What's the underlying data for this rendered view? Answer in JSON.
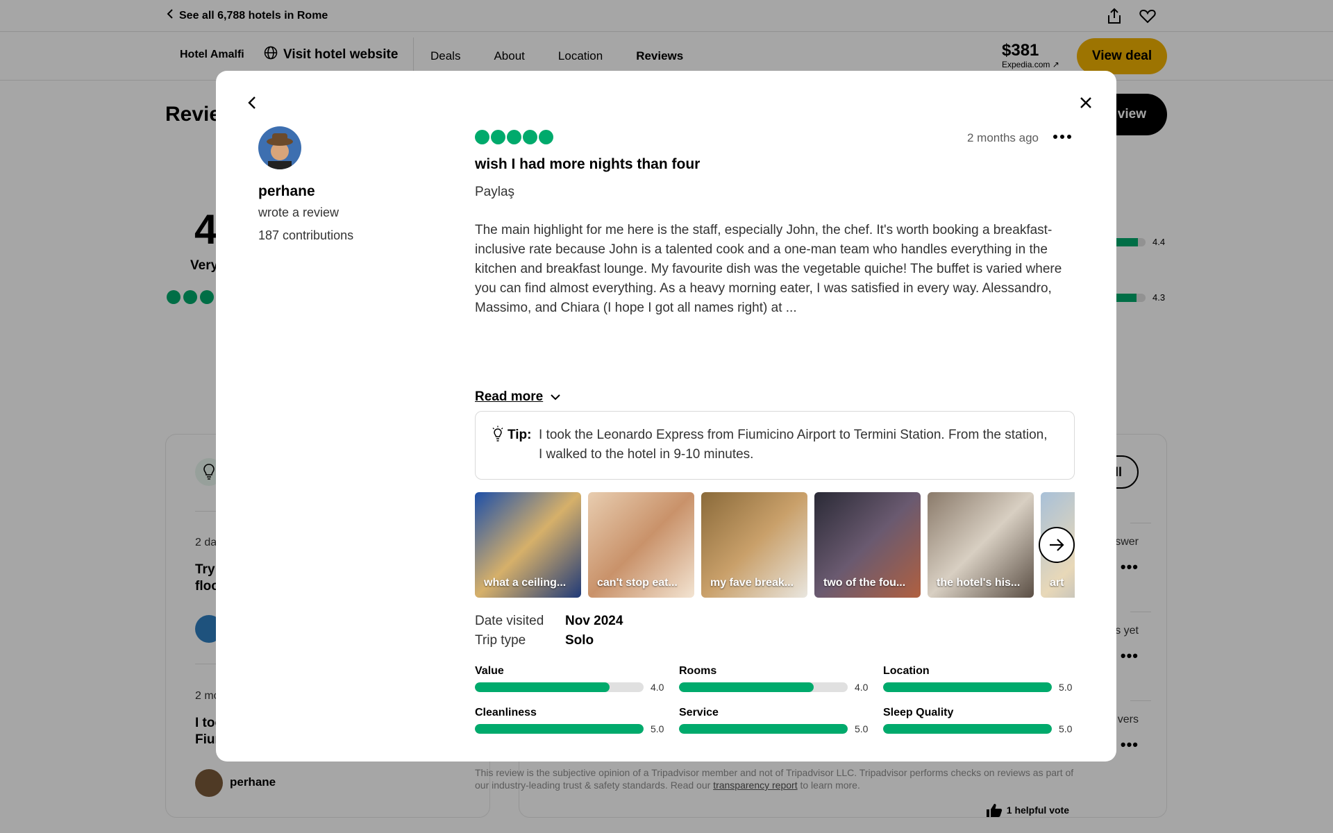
{
  "topbar": {
    "back_label": "See all 6,788 hotels in Rome",
    "share_icon": "share-icon",
    "save_icon": "heart-icon"
  },
  "subnav": {
    "hotel_name": "Hotel Amalfi",
    "visit_website": "Visit hotel website",
    "tabs": [
      "Deals",
      "About",
      "Location",
      "Reviews"
    ],
    "price": "$381",
    "price_source": "Expedia.com ↗",
    "view_deal": "View deal"
  },
  "background": {
    "reviews_heading": "Revie",
    "write_review": "view",
    "rating_value": "4",
    "rating_word": "Very",
    "bar_scores": [
      "4.4",
      "4.3"
    ],
    "bar_fill": [
      0.88,
      0.86
    ],
    "left_card": {
      "item1_date": "2 da",
      "item1_title_l1": "Try",
      "item1_title_l2": "floo",
      "item2_date": "2 mo",
      "item2_title_l1": "I too",
      "item2_title_l2": "Fium",
      "user": "perhane"
    },
    "right_card": {
      "see_all": "ll",
      "answer_1": "swer",
      "answer_2": "s yet",
      "answer_3": "vers"
    }
  },
  "review": {
    "author": "perhane",
    "author_action": "wrote a review",
    "contributions": "187 contributions",
    "bubbles": 5,
    "date_ago": "2 months ago",
    "title": "wish I had more nights than four",
    "subtitle": "Paylaş",
    "body": "The main highlight for me here is the staff, especially John, the chef. It's worth booking a breakfast-inclusive rate because John is a talented cook and a one-man team who handles everything in the kitchen and breakfast lounge. My favourite dish was the vegetable quiche! The buffet is varied where you can find almost everything. As a heavy morning eater, I was satisfied in every way. Alessandro, Massimo, and Chiara (I hope I got all names right) at ...",
    "read_more": "Read more",
    "tip_label": "Tip:",
    "tip_text": "I took the Leonardo Express from Fiumicino Airport to Termini Station. From the station, I walked to the hotel in 9-10 minutes.",
    "photos": [
      {
        "caption": "what a ceiling...",
        "colors": [
          "#1d4fa8",
          "#d6b06a",
          "#203a78"
        ]
      },
      {
        "caption": "can't stop eat...",
        "colors": [
          "#e8cdb0",
          "#c9926a",
          "#f3e4d2"
        ]
      },
      {
        "caption": "my fave break...",
        "colors": [
          "#8a6a3a",
          "#c9a06a",
          "#e9e6df"
        ]
      },
      {
        "caption": "two of the fou...",
        "colors": [
          "#2a2a36",
          "#6a5a70",
          "#b06040"
        ]
      },
      {
        "caption": "the hotel's his...",
        "colors": [
          "#8a7a6a",
          "#d8cfc2",
          "#5a4e44"
        ]
      },
      {
        "caption": "art",
        "colors": [
          "#a8c0d8",
          "#e8d8b8",
          "#8aa0c0"
        ]
      }
    ],
    "date_visited_label": "Date visited",
    "date_visited": "Nov 2024",
    "trip_type_label": "Trip type",
    "trip_type": "Solo",
    "subratings": [
      {
        "label": "Value",
        "value": "4.0",
        "fill": 0.8
      },
      {
        "label": "Rooms",
        "value": "4.0",
        "fill": 0.8
      },
      {
        "label": "Location",
        "value": "5.0",
        "fill": 1.0
      },
      {
        "label": "Cleanliness",
        "value": "5.0",
        "fill": 1.0
      },
      {
        "label": "Service",
        "value": "5.0",
        "fill": 1.0
      },
      {
        "label": "Sleep Quality",
        "value": "5.0",
        "fill": 1.0
      }
    ],
    "disclaimer_pre": "This review is the subjective opinion of a Tripadvisor member and not of Tripadvisor LLC. Tripadvisor performs checks on reviews as part of our industry-leading trust & safety standards. Read our ",
    "disclaimer_link": "transparency report",
    "disclaimer_post": " to learn more.",
    "helpful_votes": "1 helpful vote"
  },
  "colors": {
    "accent_green": "#00aa6c",
    "deal_yellow": "#f2b203"
  }
}
